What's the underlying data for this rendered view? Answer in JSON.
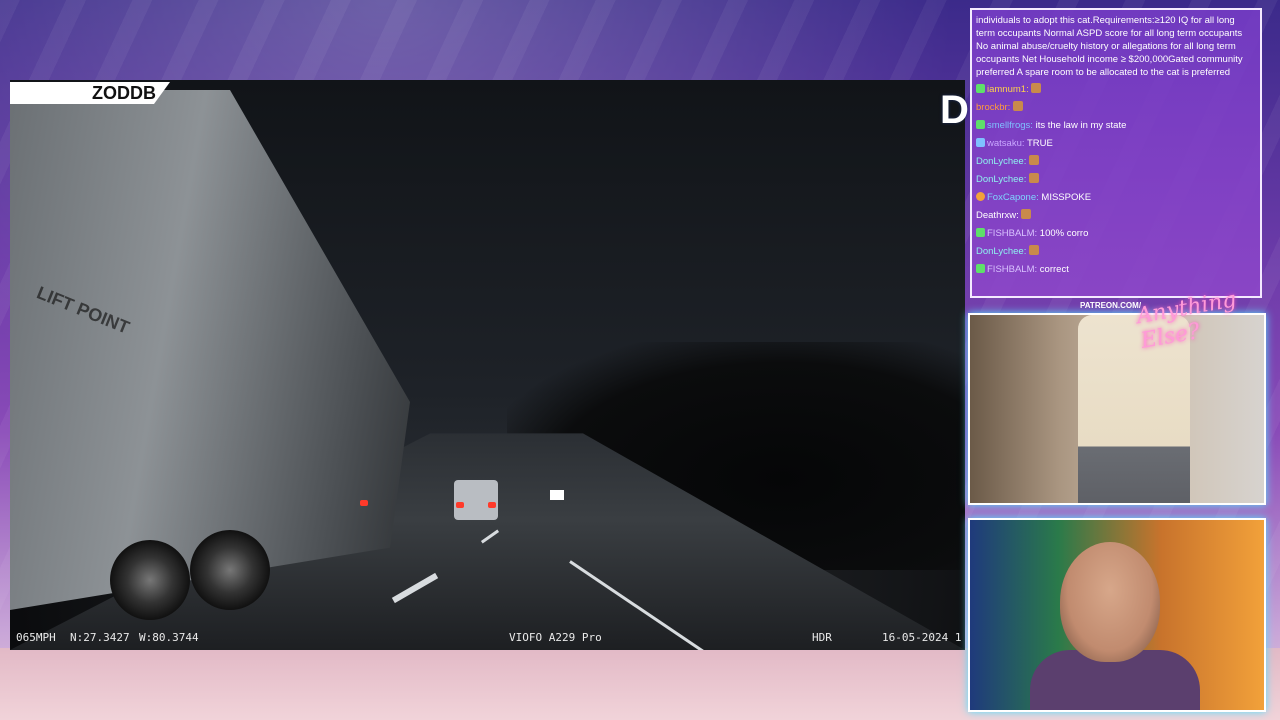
{
  "video_overlay": {
    "channel_tag": "ZODDB",
    "speed": "065MPH",
    "latitude": "N:27.3427",
    "longitude": "W:80.3744",
    "camera_model": "VIOFO A229 Pro",
    "hdr": "HDR",
    "date": "16-05-2024 1"
  },
  "chat": {
    "pinned_message": "individuals to adopt this cat.Requirements:≥120 IQ for all long term occupants Normal ASPD score for all long term occupants No animal abuse/cruelty history or allegations for all long term occupants Net Household income ≥ $200,000Gated community preferred A spare room to be allocated to the cat is preferred",
    "messages": [
      {
        "user": "iamnum1:",
        "text": "",
        "user_color": "#ffd24a",
        "badge": "star",
        "emote": true
      },
      {
        "user": "brockbr:",
        "text": "",
        "user_color": "#ff9a3c",
        "badge": "",
        "emote": true
      },
      {
        "user": "smellfrogs:",
        "text": "its the law in my state",
        "user_color": "#7fc0ff",
        "badge": "star",
        "emote": false
      },
      {
        "user": "watsaku:",
        "text": "TRUE",
        "user_color": "#c9a7ff",
        "badge": "sword",
        "emote": false
      },
      {
        "user": "DonLychee:",
        "text": "",
        "user_color": "#8ff0f0",
        "badge": "",
        "emote": true
      },
      {
        "user": "DonLychee:",
        "text": "",
        "user_color": "#8ff0f0",
        "badge": "",
        "emote": true
      },
      {
        "user": "FoxCapone:",
        "text": "MISSPOKE",
        "user_color": "#7fd4ff",
        "badge": "coin",
        "emote": false
      },
      {
        "user": "Deathrxw:",
        "text": "",
        "user_color": "#ffffff",
        "badge": "",
        "emote": true
      },
      {
        "user": "FISHBALM:",
        "text": "100% corro",
        "user_color": "#d9c2ff",
        "badge": "star",
        "emote": false
      },
      {
        "user": "DonLychee:",
        "text": "",
        "user_color": "#8ff0f0",
        "badge": "",
        "emote": true
      },
      {
        "user": "FISHBALM:",
        "text": "correct",
        "user_color": "#d9c2ff",
        "badge": "star",
        "emote": false
      }
    ]
  },
  "branding": {
    "patreon": "PATREON.COM/",
    "logo_text": "Anything Else?"
  },
  "colors": {
    "accent_cyan": "#53e0ff",
    "accent_pink": "#ff4fb8"
  }
}
